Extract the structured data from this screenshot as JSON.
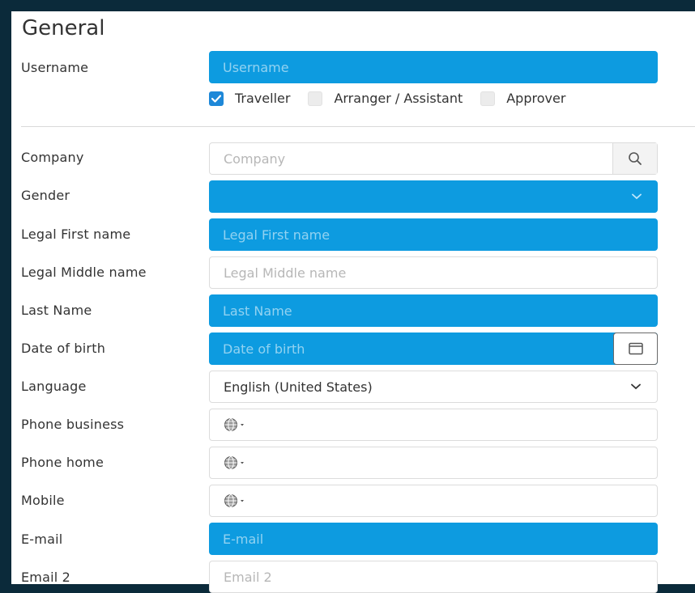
{
  "section": {
    "title": "General"
  },
  "username": {
    "label": "Username",
    "placeholder": "Username"
  },
  "roles": [
    {
      "label": "Traveller",
      "checked": true
    },
    {
      "label": "Arranger / Assistant",
      "checked": false
    },
    {
      "label": "Approver",
      "checked": false
    }
  ],
  "company": {
    "label": "Company",
    "placeholder": "Company",
    "icon": "search-icon"
  },
  "gender": {
    "label": "Gender",
    "value": "",
    "icon": "chevron-down-icon"
  },
  "legal_first": {
    "label": "Legal First name",
    "placeholder": "Legal First name"
  },
  "legal_middle": {
    "label": "Legal Middle name",
    "placeholder": "Legal Middle name"
  },
  "last_name": {
    "label": "Last Name",
    "placeholder": "Last Name"
  },
  "dob": {
    "label": "Date of birth",
    "placeholder": "Date of birth",
    "icon": "calendar-icon"
  },
  "language": {
    "label": "Language",
    "value": "English (United States)",
    "icon": "chevron-down-icon"
  },
  "phone_business": {
    "label": "Phone business",
    "icon": "globe-icon"
  },
  "phone_home": {
    "label": "Phone home",
    "icon": "globe-icon"
  },
  "mobile": {
    "label": "Mobile",
    "icon": "globe-icon"
  },
  "email": {
    "label": "E-mail",
    "placeholder": "E-mail"
  },
  "email2": {
    "label": "Email 2",
    "placeholder": "Email 2"
  },
  "colors": {
    "accent": "#0d9be0",
    "checkbox": "#1e88d8",
    "background": "#0b2a3a"
  }
}
